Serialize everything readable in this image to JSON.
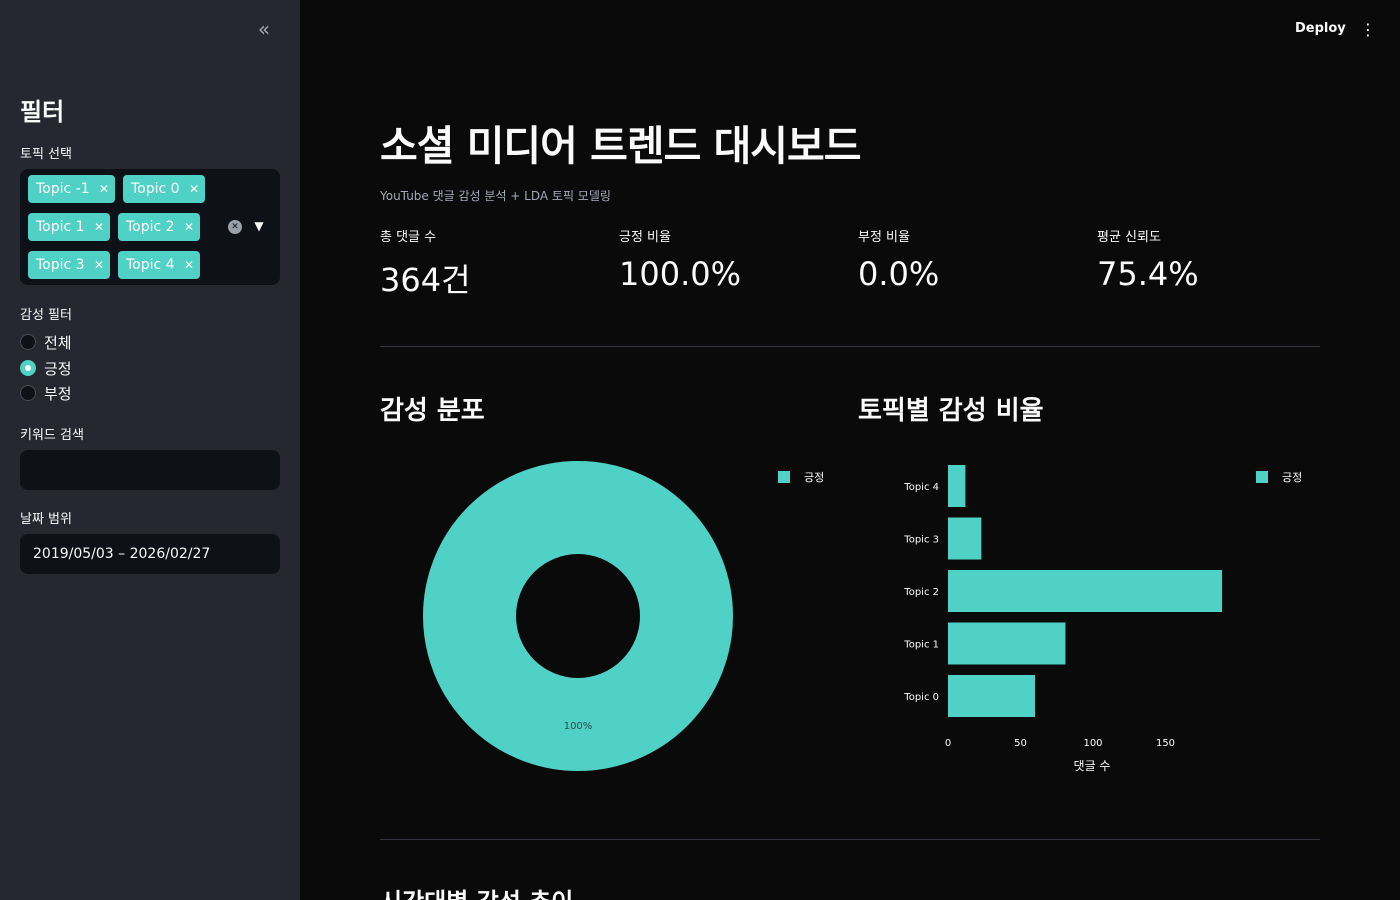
{
  "sidebar": {
    "title": "필터",
    "topic_label": "토픽 선택",
    "topics": [
      "Topic -1",
      "Topic 0",
      "Topic 1",
      "Topic 2",
      "Topic 3",
      "Topic 4"
    ],
    "sentiment_label": "감성 필터",
    "sentiment_options": [
      "전체",
      "긍정",
      "부정"
    ],
    "sentiment_selected": "긍정",
    "keyword_label": "키워드 검색",
    "keyword_value": "",
    "date_label": "날짜 범위",
    "date_value": "2019/05/03 – 2026/02/27"
  },
  "header": {
    "deploy_label": "Deploy"
  },
  "main": {
    "title": "소셜 미디어 트렌드 대시보드",
    "caption": "YouTube 댓글 감성 분석 + LDA 토픽 모델링",
    "metrics": [
      {
        "label": "총 댓글 수",
        "value": "364건"
      },
      {
        "label": "긍정 비율",
        "value": "100.0%"
      },
      {
        "label": "부정 비율",
        "value": "0.0%"
      },
      {
        "label": "평균 신뢰도",
        "value": "75.4%"
      }
    ],
    "section_sentiment": "감성 분포",
    "section_topic": "토픽별 감성 비율",
    "section_trend": "시간대별 감성 추이"
  },
  "colors": {
    "accent": "#4fd1c5",
    "sidebar_bg": "#262730",
    "main_bg": "#0a0a0a"
  },
  "chart_data": [
    {
      "type": "pie",
      "categories": [
        "긍정"
      ],
      "values": [
        100
      ],
      "data_labels": [
        "100%"
      ],
      "legend": [
        "긍정"
      ],
      "legend_position": "top-right",
      "donut": true
    },
    {
      "type": "bar",
      "orientation": "horizontal",
      "categories": [
        "Topic 4",
        "Topic 3",
        "Topic 2",
        "Topic 1",
        "Topic 0"
      ],
      "series": [
        {
          "name": "긍정",
          "values": [
            12,
            23,
            189,
            81,
            60
          ]
        }
      ],
      "xlabel": "댓글 수",
      "xticks": [
        0,
        50,
        100,
        150
      ],
      "xlim": [
        0,
        200
      ],
      "legend_position": "top-right"
    }
  ]
}
